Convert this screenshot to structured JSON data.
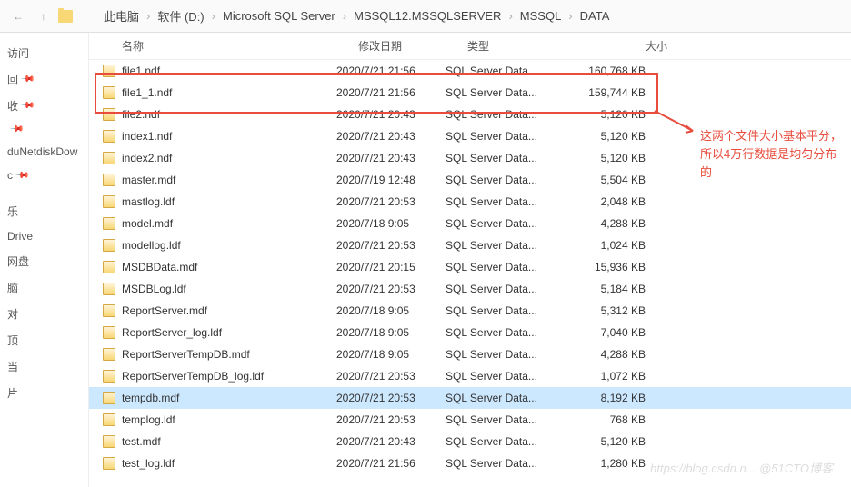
{
  "toolbar": {
    "back": "←",
    "forward": "→",
    "up": "↑"
  },
  "breadcrumb": [
    "此电脑",
    "软件 (D:)",
    "Microsoft SQL Server",
    "MSSQL12.MSSQLSERVER",
    "MSSQL",
    "DATA"
  ],
  "sidebar": [
    {
      "label": "访问",
      "pin": false
    },
    {
      "label": "回",
      "pin": true
    },
    {
      "label": "收",
      "pin": true
    },
    {
      "label": "",
      "pin": true
    },
    {
      "label": "duNetdiskDow",
      "pin": false
    },
    {
      "label": "c",
      "pin": true
    },
    {
      "label": "",
      "pin": false
    },
    {
      "label": "乐",
      "pin": false
    },
    {
      "label": "Drive",
      "pin": false
    },
    {
      "label": "网盘",
      "pin": false
    },
    {
      "label": "脑",
      "pin": false
    },
    {
      "label": "对",
      "pin": false
    },
    {
      "label": "顶",
      "pin": false
    },
    {
      "label": "当",
      "pin": false
    },
    {
      "label": "片",
      "pin": false
    }
  ],
  "headers": {
    "name": "名称",
    "date": "修改日期",
    "type": "类型",
    "size": "大小"
  },
  "files": [
    {
      "name": "file1.ndf",
      "date": "2020/7/21 21:56",
      "type": "SQL Server Data...",
      "size": "160,768 KB",
      "sel": false
    },
    {
      "name": "file1_1.ndf",
      "date": "2020/7/21 21:56",
      "type": "SQL Server Data...",
      "size": "159,744 KB",
      "sel": false
    },
    {
      "name": "file2.ndf",
      "date": "2020/7/21 20:43",
      "type": "SQL Server Data...",
      "size": "5,120 KB",
      "sel": false
    },
    {
      "name": "index1.ndf",
      "date": "2020/7/21 20:43",
      "type": "SQL Server Data...",
      "size": "5,120 KB",
      "sel": false
    },
    {
      "name": "index2.ndf",
      "date": "2020/7/21 20:43",
      "type": "SQL Server Data...",
      "size": "5,120 KB",
      "sel": false
    },
    {
      "name": "master.mdf",
      "date": "2020/7/19 12:48",
      "type": "SQL Server Data...",
      "size": "5,504 KB",
      "sel": false
    },
    {
      "name": "mastlog.ldf",
      "date": "2020/7/21 20:53",
      "type": "SQL Server Data...",
      "size": "2,048 KB",
      "sel": false
    },
    {
      "name": "model.mdf",
      "date": "2020/7/18 9:05",
      "type": "SQL Server Data...",
      "size": "4,288 KB",
      "sel": false
    },
    {
      "name": "modellog.ldf",
      "date": "2020/7/21 20:53",
      "type": "SQL Server Data...",
      "size": "1,024 KB",
      "sel": false
    },
    {
      "name": "MSDBData.mdf",
      "date": "2020/7/21 20:15",
      "type": "SQL Server Data...",
      "size": "15,936 KB",
      "sel": false
    },
    {
      "name": "MSDBLog.ldf",
      "date": "2020/7/21 20:53",
      "type": "SQL Server Data...",
      "size": "5,184 KB",
      "sel": false
    },
    {
      "name": "ReportServer.mdf",
      "date": "2020/7/18 9:05",
      "type": "SQL Server Data...",
      "size": "5,312 KB",
      "sel": false
    },
    {
      "name": "ReportServer_log.ldf",
      "date": "2020/7/18 9:05",
      "type": "SQL Server Data...",
      "size": "7,040 KB",
      "sel": false
    },
    {
      "name": "ReportServerTempDB.mdf",
      "date": "2020/7/18 9:05",
      "type": "SQL Server Data...",
      "size": "4,288 KB",
      "sel": false
    },
    {
      "name": "ReportServerTempDB_log.ldf",
      "date": "2020/7/21 20:53",
      "type": "SQL Server Data...",
      "size": "1,072 KB",
      "sel": false
    },
    {
      "name": "tempdb.mdf",
      "date": "2020/7/21 20:53",
      "type": "SQL Server Data...",
      "size": "8,192 KB",
      "sel": true
    },
    {
      "name": "templog.ldf",
      "date": "2020/7/21 20:53",
      "type": "SQL Server Data...",
      "size": "768 KB",
      "sel": false
    },
    {
      "name": "test.mdf",
      "date": "2020/7/21 20:43",
      "type": "SQL Server Data...",
      "size": "5,120 KB",
      "sel": false
    },
    {
      "name": "test_log.ldf",
      "date": "2020/7/21 21:56",
      "type": "SQL Server Data...",
      "size": "1,280 KB",
      "sel": false
    }
  ],
  "annotation": "这两个文件大小基本平分，所以4万行数据是均匀分布的",
  "watermark": "https://blog.csdn.n... @51CTO博客"
}
